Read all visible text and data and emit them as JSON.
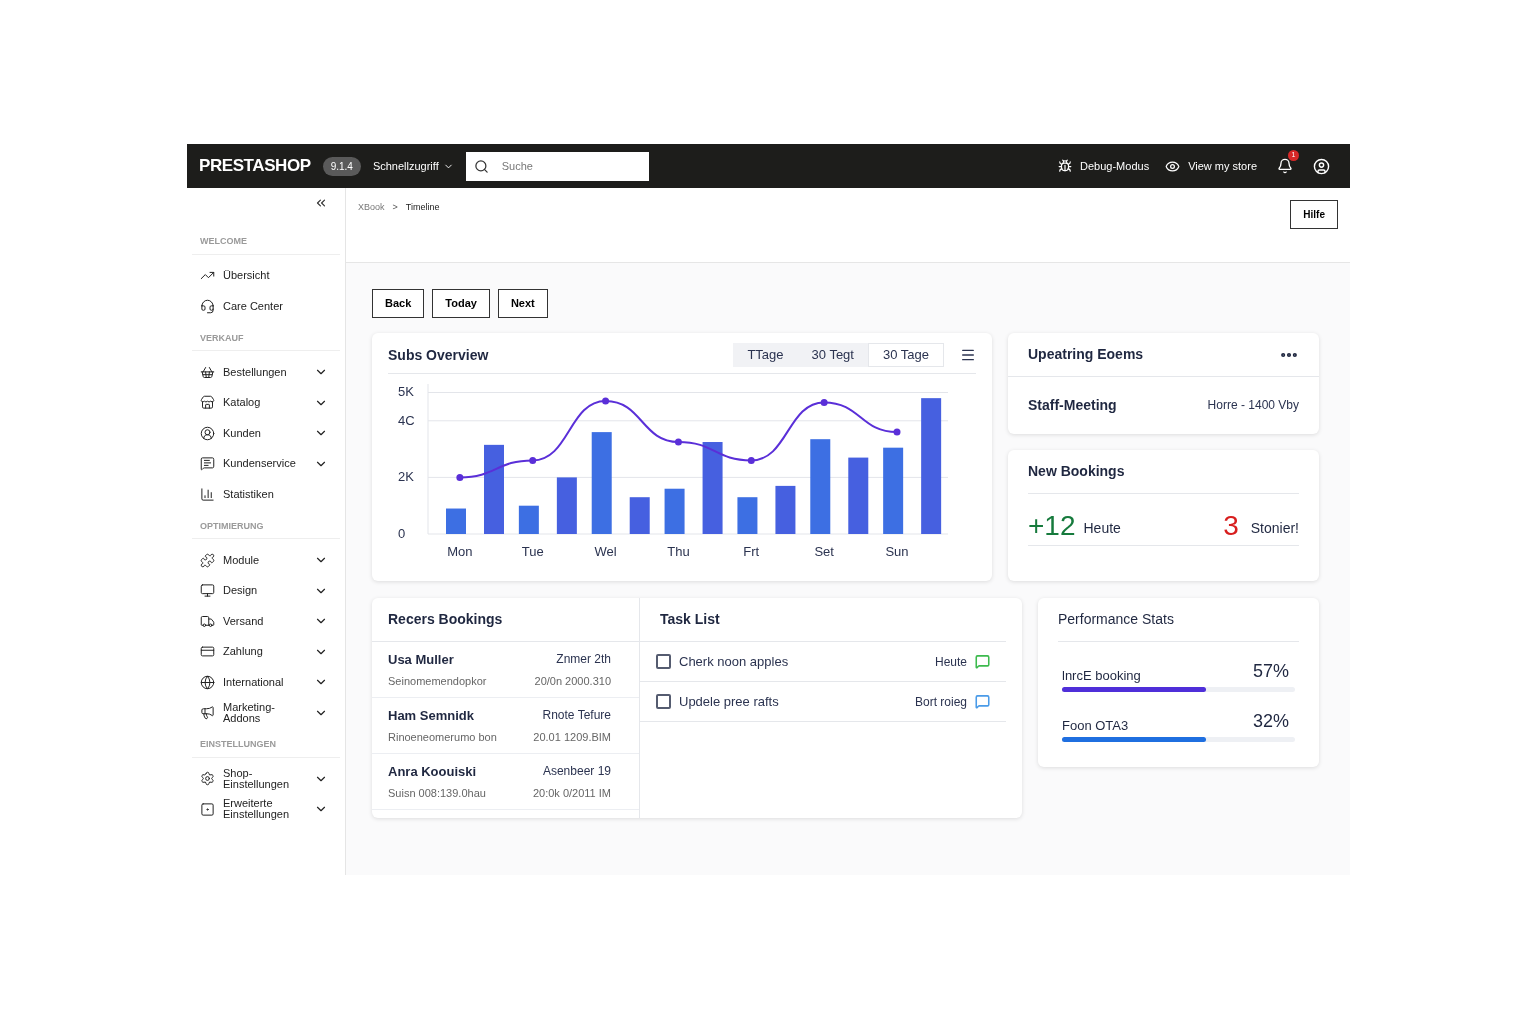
{
  "topbar": {
    "logo": "PRESTASHOP",
    "version": "9.1.4",
    "quick_access": "Schnellzugriff",
    "search": {
      "placeholder": "Suche"
    },
    "debug": "Debug-Modus",
    "view_store": "View my store",
    "notifications": "1"
  },
  "sidebar": {
    "sections": [
      {
        "title": "WELCOME",
        "items": [
          {
            "label": "Übersicht",
            "has_submenu": false
          },
          {
            "label": "Care Center",
            "has_submenu": false
          }
        ]
      },
      {
        "title": "VERKAUF",
        "items": [
          {
            "label": "Bestellungen",
            "has_submenu": true
          },
          {
            "label": "Katalog",
            "has_submenu": true
          },
          {
            "label": "Kunden",
            "has_submenu": true
          },
          {
            "label": "Kundenservice",
            "has_submenu": true
          },
          {
            "label": "Statistiken",
            "has_submenu": false
          }
        ]
      },
      {
        "title": "OPTIMIERUNG",
        "items": [
          {
            "label": "Module",
            "has_submenu": true
          },
          {
            "label": "Design",
            "has_submenu": true
          },
          {
            "label": "Versand",
            "has_submenu": true
          },
          {
            "label": "Zahlung",
            "has_submenu": true
          },
          {
            "label": "International",
            "has_submenu": true
          },
          {
            "label": "Marketing-\nAddons",
            "has_submenu": true
          }
        ]
      },
      {
        "title": "EINSTELLUNGEN",
        "items": [
          {
            "label": "Shop-\nEinstellungen",
            "has_submenu": true
          },
          {
            "label": "Erweiterte\nEinstellungen",
            "has_submenu": true
          }
        ]
      }
    ]
  },
  "breadcrumb": [
    "XBook",
    "Timeline"
  ],
  "breadcrumb_separator": ">",
  "help_button": "Hilfe",
  "nav_buttons": [
    "Back",
    "Today",
    "Next"
  ],
  "overview": {
    "title": "Subs Overview",
    "tabs": [
      {
        "label": "TTage",
        "selected": false
      },
      {
        "label": "30 Tegt",
        "selected": false
      },
      {
        "label": "30 Tage",
        "selected": true
      }
    ],
    "chart_data": {
      "type": "bar",
      "categories": [
        "Mon",
        "Tue",
        "Wel",
        "Thu",
        "Frt",
        "Set",
        "Sun"
      ],
      "stacked": false,
      "grid": true,
      "series": [
        {
          "type": "bar",
          "color": "#3d6fe3",
          "values": [
            0.9,
            1.0,
            3.6,
            1.6,
            1.3,
            3.35,
            3.05
          ]
        },
        {
          "type": "bar",
          "color": "#4660e0",
          "values": [
            3.15,
            2.0,
            1.3,
            3.25,
            1.7,
            2.7,
            4.8
          ]
        },
        {
          "type": "line",
          "marker": true,
          "color": "#5a2fd8",
          "values": [
            2.0,
            2.6,
            4.7,
            3.25,
            2.6,
            4.65,
            3.6
          ]
        }
      ],
      "ylim": [
        0,
        5.3
      ],
      "yticks": [
        {
          "value": 0,
          "label": "0"
        },
        {
          "value": 2,
          "label": "2K"
        },
        {
          "value": 4,
          "label": "4C"
        },
        {
          "value": 5,
          "label": "5K"
        }
      ]
    }
  },
  "upcoming": {
    "title": "Upeatring Eoems",
    "events": [
      {
        "name": "Staff-Meeting",
        "time": "Horre - 1400 Vby"
      }
    ]
  },
  "new_bookings": {
    "title": "New Bookings",
    "today_count": "+12",
    "today_label": "Heute",
    "cancel_count": "3",
    "cancel_label": "Stonier!"
  },
  "recent_bookings": {
    "title": "Recers Bookings",
    "rows": [
      {
        "name": "Usa Muller",
        "detail": "Seinomemendopkor",
        "date": "Znmer 2th",
        "time": "20/0n 2000.310"
      },
      {
        "name": "Ham Semnidk",
        "detail": "Rinoeneomerumo bon",
        "date": "Rnote Tefure",
        "time": "20.01 1209.BIM"
      },
      {
        "name": "Anra Koouiski",
        "detail": "Suisn 008:139.0hau",
        "date": "Asenbeer 19",
        "time": "20:0k 0/2011 IM"
      }
    ]
  },
  "tasks": {
    "title": "Task List",
    "items": [
      {
        "label": "Cherk noon apples",
        "checked": false,
        "tag": "Heute",
        "color": "#3dba4e"
      },
      {
        "label": "Updele pree rafts",
        "checked": false,
        "tag": "Bort roieg",
        "color": "#4a9be8"
      }
    ]
  },
  "performance": {
    "title": "Performance Stats",
    "metrics": [
      {
        "label": "lnrcE booking",
        "value": "57%",
        "level": 0.62,
        "color": "#4f2fd9"
      },
      {
        "label": "Foon OTA3",
        "value": "32%",
        "level": 0.62,
        "color": "#1f6fe0"
      }
    ]
  }
}
